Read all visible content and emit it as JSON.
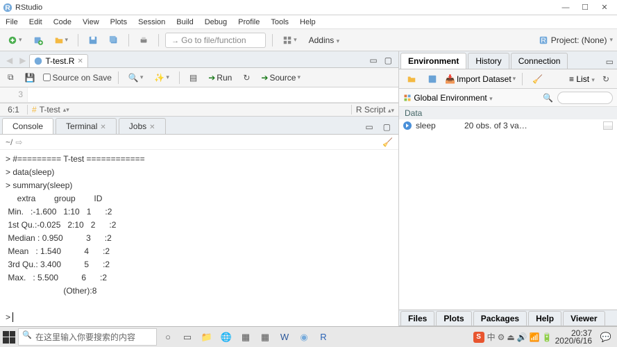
{
  "window": {
    "title": "RStudio"
  },
  "menu": [
    "File",
    "Edit",
    "Code",
    "View",
    "Plots",
    "Session",
    "Build",
    "Debug",
    "Profile",
    "Tools",
    "Help"
  ],
  "toolbar": {
    "goto_placeholder": "Go to file/function",
    "addins": "Addins",
    "project": "Project: (None)"
  },
  "source": {
    "tab": "T-test.R",
    "source_on_save": "Source on Save",
    "run": "Run",
    "source_btn": "Source",
    "line_no": "3",
    "pos": "6:1",
    "fn_picker": "T-test",
    "rscript": "R Script"
  },
  "console": {
    "tabs": {
      "console": "Console",
      "terminal": "Terminal",
      "jobs": "Jobs"
    },
    "path": "~/",
    "output": "> #========= T-test ============\n> data(sleep)\n> summary(sleep)\n     extra        group        ID   \n Min.   :-1.600   1:10   1      :2  \n 1st Qu.:-0.025   2:10   2      :2  \n Median : 0.950          3      :2  \n Mean   : 1.540          4      :2  \n 3rd Qu.: 3.400          5      :2  \n Max.   : 5.500          6      :2  \n                         (Other):8  \n\n> "
  },
  "env": {
    "tabs": {
      "env": "Environment",
      "history": "History",
      "conn": "Connection"
    },
    "import": "Import Dataset",
    "list": "List",
    "scope": "Global Environment",
    "section": "Data",
    "row": {
      "name": "sleep",
      "value": "20 obs. of 3 va…"
    }
  },
  "help_tabs": [
    "Files",
    "Plots",
    "Packages",
    "Help",
    "Viewer"
  ],
  "taskbar": {
    "search_placeholder": "在这里输入你要搜索的内容",
    "ime": "中",
    "time": "20:37",
    "date": "2020/6/16"
  }
}
